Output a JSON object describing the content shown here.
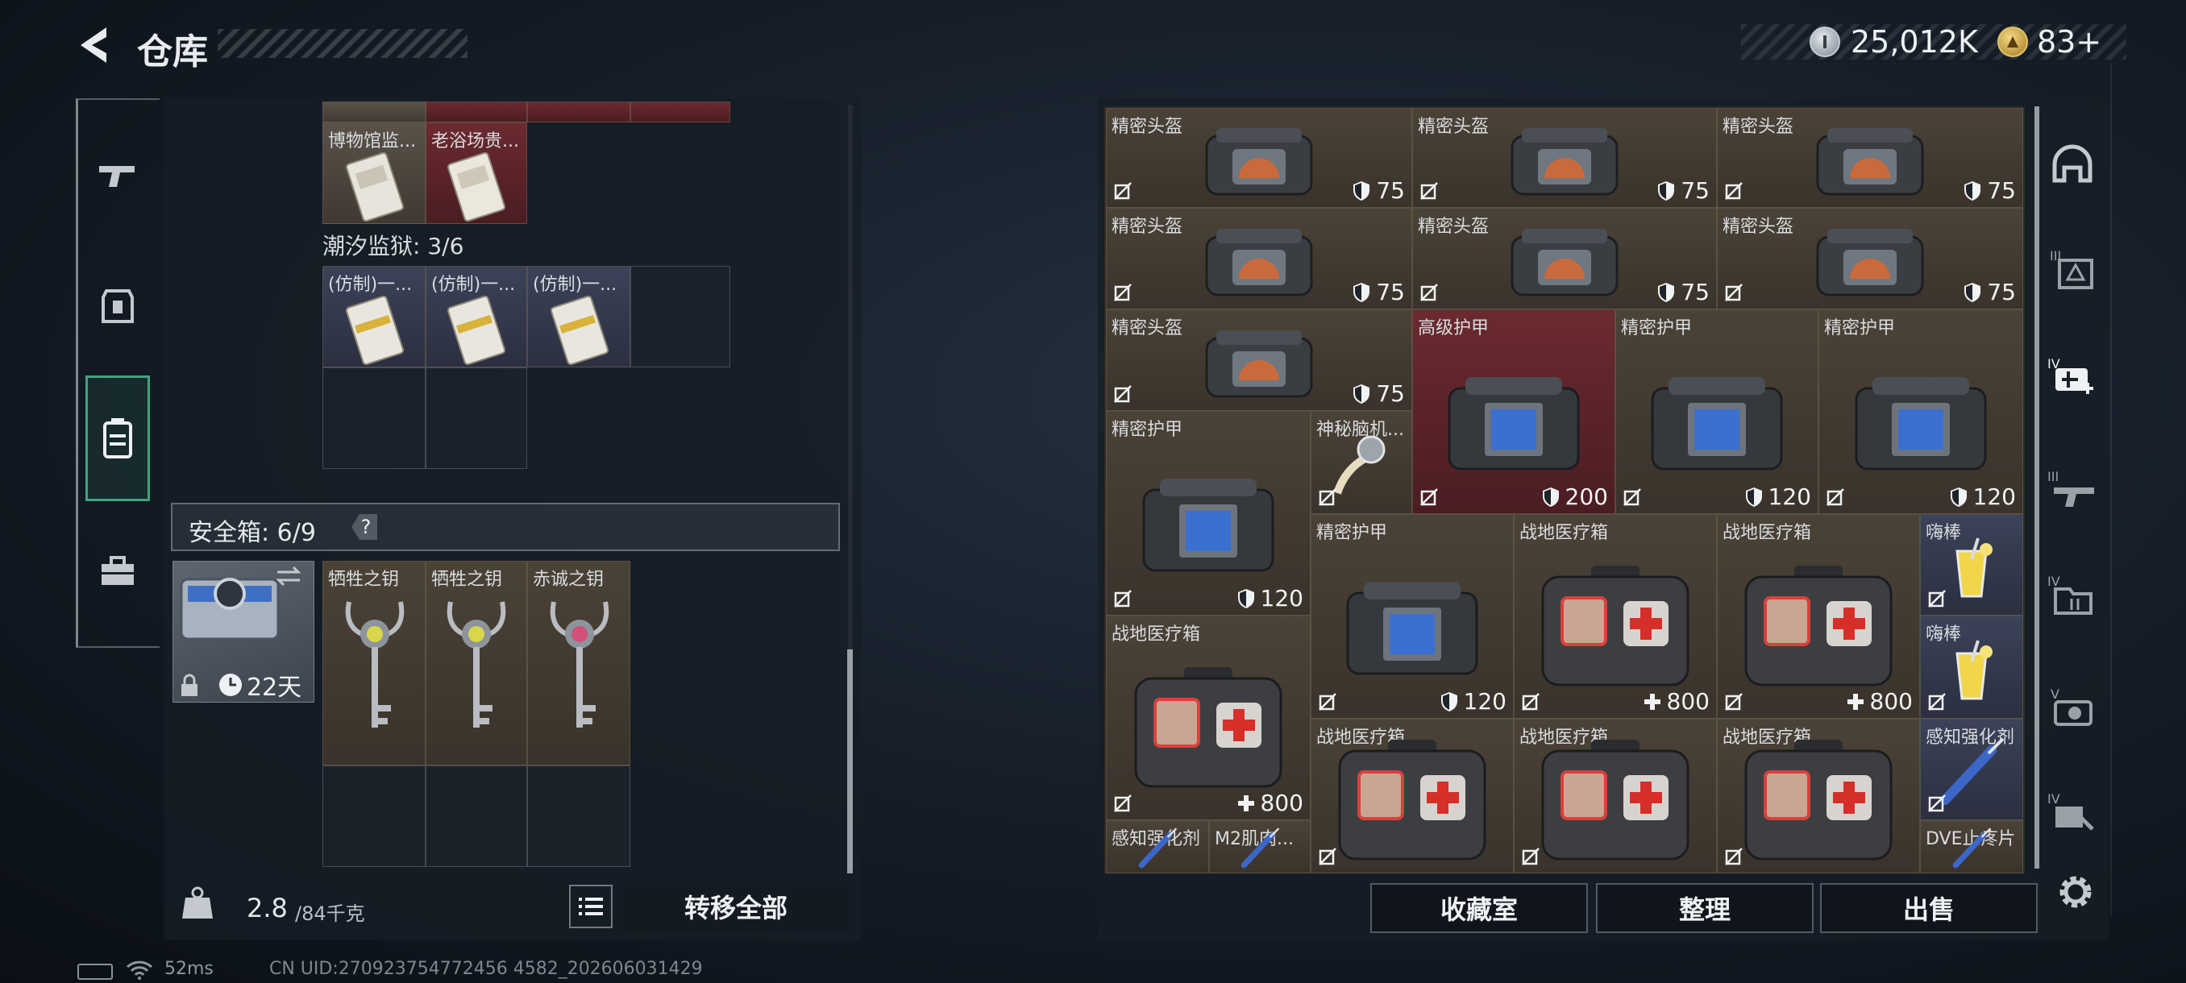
{
  "header": {
    "title": "仓库",
    "coins": "25,012K",
    "tickets": "83+"
  },
  "left_tabs": [
    {
      "name": "weapons",
      "icon": "gun-icon"
    },
    {
      "name": "gear",
      "icon": "armor-icon"
    },
    {
      "name": "container",
      "icon": "backpack-icon",
      "active": true
    },
    {
      "name": "case",
      "icon": "briefcase-icon"
    }
  ],
  "storage": {
    "top_items": [
      {
        "name": "博物馆监..."
      },
      {
        "name": "老浴场贵..."
      }
    ],
    "prison_label": "潮汐监狱: 3/6",
    "prison_items": [
      {
        "name": "(仿制)一..."
      },
      {
        "name": "(仿制)一..."
      },
      {
        "name": "(仿制)一..."
      }
    ]
  },
  "safebox": {
    "label": "安全箱: 6/9",
    "help": "?",
    "timer": "22天",
    "keys": [
      {
        "name": "牺牲之钥"
      },
      {
        "name": "牺牲之钥"
      },
      {
        "name": "赤诚之钥"
      }
    ]
  },
  "weight": {
    "current": "2.8",
    "capacity": "/84千克"
  },
  "transfer_all": "转移全部",
  "inventory_items": [
    {
      "name": "精密头盔",
      "value": "75",
      "kind": "helmet"
    },
    {
      "name": "精密头盔",
      "value": "75",
      "kind": "helmet"
    },
    {
      "name": "精密头盔",
      "value": "75",
      "kind": "helmet"
    },
    {
      "name": "精密头盔",
      "value": "75",
      "kind": "helmet"
    },
    {
      "name": "精密头盔",
      "value": "75",
      "kind": "helmet"
    },
    {
      "name": "精密头盔",
      "value": "75",
      "kind": "helmet"
    },
    {
      "name": "精密头盔",
      "value": "75",
      "kind": "helmet"
    },
    {
      "name": "高级护甲",
      "value": "200",
      "kind": "armor"
    },
    {
      "name": "精密护甲",
      "value": "120",
      "kind": "armor"
    },
    {
      "name": "精密护甲",
      "value": "120",
      "kind": "armor"
    },
    {
      "name": "精密护甲",
      "value": "120",
      "kind": "armor"
    },
    {
      "name": "神秘脑机...",
      "value": "",
      "kind": "chip"
    },
    {
      "name": "精密护甲",
      "value": "120",
      "kind": "armor"
    },
    {
      "name": "战地医疗箱",
      "value": "800",
      "kind": "medkit"
    },
    {
      "name": "战地医疗箱",
      "value": "800",
      "kind": "medkit"
    },
    {
      "name": "嗨棒",
      "value": "",
      "kind": "drink"
    },
    {
      "name": "嗨棒",
      "value": "",
      "kind": "drink"
    },
    {
      "name": "战地医疗箱",
      "value": "800",
      "kind": "medkit"
    },
    {
      "name": "战地医疗箱",
      "value": "",
      "kind": "medkit"
    },
    {
      "name": "战地医疗箱",
      "value": "",
      "kind": "medkit"
    },
    {
      "name": "战地医疗箱",
      "value": "",
      "kind": "medkit"
    },
    {
      "name": "感知强化剂",
      "value": "",
      "kind": "syringe"
    },
    {
      "name": "感知强化剂",
      "value": "",
      "kind": "syringe"
    },
    {
      "name": "M2肌肉...",
      "value": "",
      "kind": "syringe"
    },
    {
      "name": "DVE止疼片",
      "value": "",
      "kind": "syringe"
    }
  ],
  "buttons": {
    "collection": "收藏室",
    "organize": "整理",
    "sell": "出售"
  },
  "status": {
    "ping": "52ms",
    "uid": "CN UID:270923754772456 4582_202606031429"
  },
  "colors": {
    "accent_green": "#3fa47d",
    "item_red": "#6b2a30",
    "item_gray": "#5a5248"
  }
}
